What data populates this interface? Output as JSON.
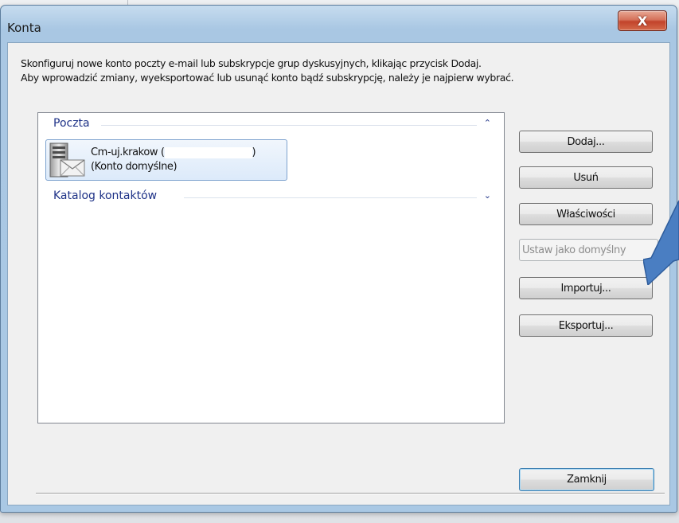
{
  "window": {
    "title": "Konta",
    "close_glyph": "X"
  },
  "description": {
    "line1": "Skonfiguruj nowe konto poczty e-mail lub subskrypcje grup dyskusyjnych, klikając przycisk Dodaj.",
    "line2": "Aby wprowadzić zmiany, wyeksportować lub usunąć konto bądź subskrypcję, należy je najpierw wybrać."
  },
  "list": {
    "groups": [
      {
        "label": "Poczta",
        "chevron": "⌃",
        "expanded": true,
        "items": [
          {
            "icon": "mail-server-icon",
            "name_prefix": "Cm-uj.krakow (",
            "name_suffix": ")",
            "subtitle": "(Konto domyślne)",
            "selected": true
          }
        ]
      },
      {
        "label": "Katalog kontaktów",
        "chevron": "⌄",
        "expanded": false,
        "items": []
      }
    ]
  },
  "buttons": {
    "add": "Dodaj...",
    "remove": "Usuń",
    "properties": "Właściwości",
    "set_default": "Ustaw jako domyślny",
    "import": "Importuj...",
    "export": "Eksportuj...",
    "close": "Zamknij"
  },
  "overlay": {
    "arrow_color": "#4a7ec2",
    "arrow_icon": "pointer-arrow-icon"
  }
}
